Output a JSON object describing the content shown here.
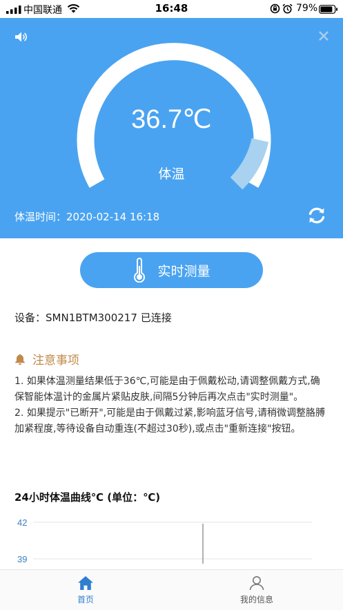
{
  "status_bar": {
    "carrier": "中国联通",
    "time": "16:48",
    "battery": "79%"
  },
  "header": {
    "temperature": "36.7℃",
    "label": "体温",
    "time_label": "体温时间：",
    "time_value": "2020-02-14 16:18",
    "gauge_fill_fraction": 0.12
  },
  "measure_button": {
    "label": "实时测量"
  },
  "device": {
    "label": "设备：",
    "id": "SMN1BTM300217",
    "state": "已连接"
  },
  "notice": {
    "title": "注意事项",
    "items": [
      "1. 如果体温测量结果低于36℃,可能是由于佩戴松动,请调整佩戴方式,确保智能体温计的金属片紧贴皮肤,间隔5分钟后再次点击\"实时测量\"。",
      "2. 如果提示\"已断开\",可能是由于佩戴过紧,影响蓝牙信号,请稍微调整胳膊加紧程度,等待设备自动重连(不超过30秒),或点击\"重新连接\"按钮。"
    ]
  },
  "curve": {
    "title": "24小时体温曲线℃ (单位：℃)"
  },
  "chart_data": {
    "type": "line",
    "title": "24小时体温曲线℃ (单位：℃)",
    "yticks": [
      "42",
      "39"
    ],
    "ylim": [
      36,
      42
    ],
    "grid": true,
    "series": []
  },
  "tabs": [
    {
      "label": "首页",
      "icon": "home-icon",
      "active": true
    },
    {
      "label": "我的信息",
      "icon": "user-icon",
      "active": false
    }
  ],
  "colors": {
    "primary": "#4aa3f0",
    "notice": "#c08a4a",
    "tab_active": "#2f7fd0"
  }
}
